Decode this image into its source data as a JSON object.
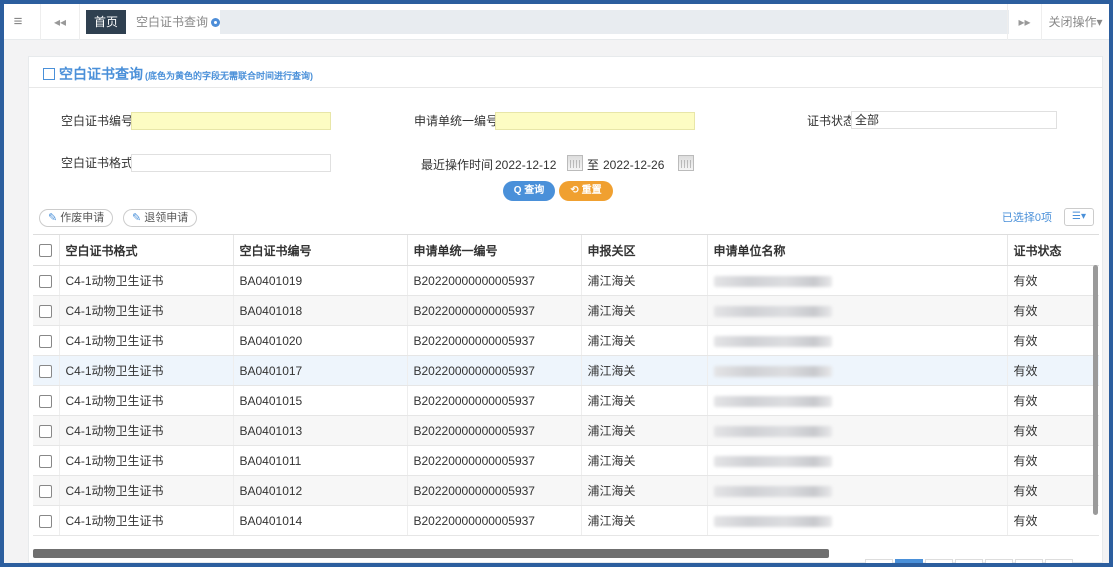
{
  "topbar": {
    "menu_icon": "menu-icon",
    "prev_icon": "double-left-icon",
    "home_tab": "首页",
    "current_tab": "空白证书查询",
    "next_icon": "double-right-icon",
    "close_ops": "关闭操作▾"
  },
  "panel": {
    "title": "空白证书查询",
    "subtitle": "(底色为黄色的字段无需联合时间进行查询)"
  },
  "form": {
    "cert_no_label": "空白证书编号",
    "cert_no_value": "",
    "unit_code_label": "申请单统一编号",
    "unit_code_value": "",
    "status_label": "证书状态",
    "status_value": "全部",
    "format_label": "空白证书格式",
    "format_value": "",
    "time_label": "最近操作时间",
    "date_from": "2022-12-12",
    "date_to_label": "至",
    "date_to": "2022-12-26",
    "search_label": "Q 查询",
    "reset_label": "⟲ 重置"
  },
  "toolbar": {
    "void_label": "作废申请",
    "return_label": "退领申请",
    "selected_text": "已选择0项",
    "columns_icon": "columns-icon"
  },
  "table": {
    "headers": [
      "空白证书格式",
      "空白证书编号",
      "申请单统一编号",
      "申报关区",
      "申请单位名称",
      "证书状态"
    ],
    "rows": [
      {
        "format": "C4-1动物卫生证书",
        "cert_no": "BA0401019",
        "app_no": "B20220000000005937",
        "area": "浦江海关",
        "status": "有效"
      },
      {
        "format": "C4-1动物卫生证书",
        "cert_no": "BA0401018",
        "app_no": "B20220000000005937",
        "area": "浦江海关",
        "status": "有效"
      },
      {
        "format": "C4-1动物卫生证书",
        "cert_no": "BA0401020",
        "app_no": "B20220000000005937",
        "area": "浦江海关",
        "status": "有效"
      },
      {
        "format": "C4-1动物卫生证书",
        "cert_no": "BA0401017",
        "app_no": "B20220000000005937",
        "area": "浦江海关",
        "status": "有效"
      },
      {
        "format": "C4-1动物卫生证书",
        "cert_no": "BA0401015",
        "app_no": "B20220000000005937",
        "area": "浦江海关",
        "status": "有效"
      },
      {
        "format": "C4-1动物卫生证书",
        "cert_no": "BA0401013",
        "app_no": "B20220000000005937",
        "area": "浦江海关",
        "status": "有效"
      },
      {
        "format": "C4-1动物卫生证书",
        "cert_no": "BA0401011",
        "app_no": "B20220000000005937",
        "area": "浦江海关",
        "status": "有效"
      },
      {
        "format": "C4-1动物卫生证书",
        "cert_no": "BA0401012",
        "app_no": "B20220000000005937",
        "area": "浦江海关",
        "status": "有效"
      },
      {
        "format": "C4-1动物卫生证书",
        "cert_no": "BA0401014",
        "app_no": "B20220000000005937",
        "area": "浦江海关",
        "status": "有效"
      }
    ]
  }
}
